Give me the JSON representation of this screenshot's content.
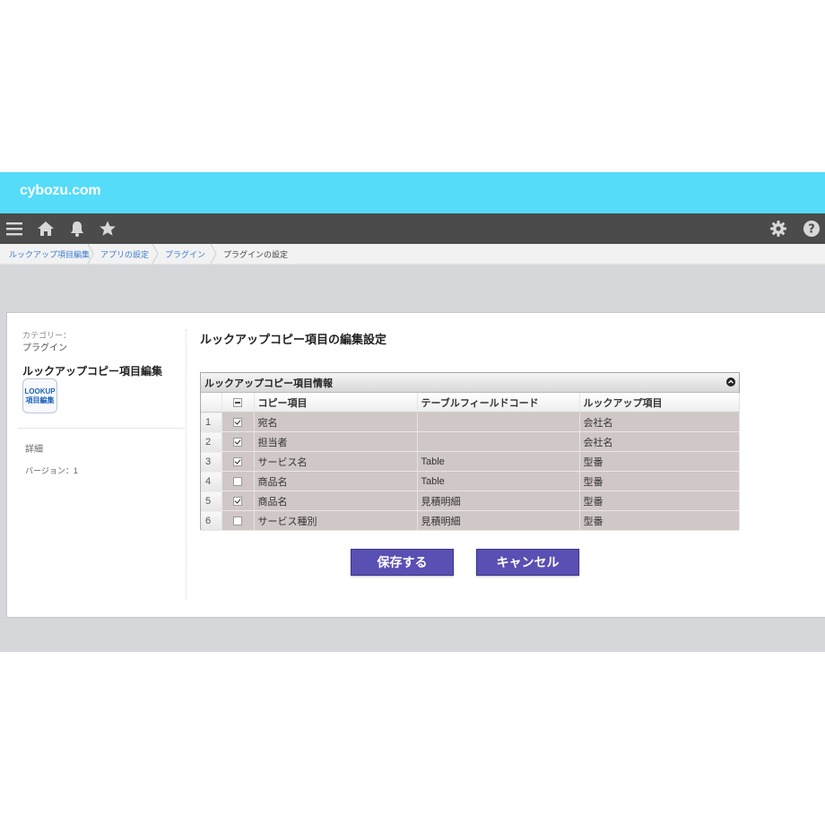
{
  "header": {
    "logo": "cybozu.com"
  },
  "nav": {
    "icons": [
      "menu-icon",
      "home-icon",
      "bell-icon",
      "star-icon",
      "gear-icon",
      "help-icon"
    ]
  },
  "breadcrumb": {
    "items": [
      {
        "label": "ルックアップ項目編集"
      },
      {
        "label": "アプリの設定"
      },
      {
        "label": "プラグイン"
      },
      {
        "label": "プラグインの設定"
      }
    ]
  },
  "sidebar": {
    "category_label": "カテゴリー：",
    "category_value": "プラグイン",
    "plugin_name": "ルックアップコピー項目編集",
    "plugin_icon": {
      "line1": "LOOKUP",
      "line2": "項目編集"
    },
    "detail": "詳細",
    "version": "バージョン：1"
  },
  "main": {
    "title": "ルックアップコピー項目の編集設定",
    "grid": {
      "caption": "ルックアップコピー項目情報",
      "columns": [
        "コピー項目",
        "テーブルフィールドコード",
        "ルックアップ項目"
      ],
      "rows": [
        {
          "num": "1",
          "checked": true,
          "copy_item": "宛名",
          "table_code": "",
          "lookup_item": "会社名"
        },
        {
          "num": "2",
          "checked": true,
          "copy_item": "担当者",
          "table_code": "",
          "lookup_item": "会社名"
        },
        {
          "num": "3",
          "checked": true,
          "copy_item": "サービス名",
          "table_code": "Table",
          "lookup_item": "型番"
        },
        {
          "num": "4",
          "checked": false,
          "copy_item": "商品名",
          "table_code": "Table",
          "lookup_item": "型番"
        },
        {
          "num": "5",
          "checked": true,
          "copy_item": "商品名",
          "table_code": "見積明細",
          "lookup_item": "型番"
        },
        {
          "num": "6",
          "checked": false,
          "copy_item": "サービス種別",
          "table_code": "見積明細",
          "lookup_item": "型番"
        }
      ]
    },
    "save_label": "保存する",
    "cancel_label": "キャンセル"
  },
  "colors": {
    "brand_bar": "#54dcf8",
    "nav_bar": "#4b4b4b",
    "button": "#5a4fb3",
    "grid_row": "#d0c7c7"
  }
}
